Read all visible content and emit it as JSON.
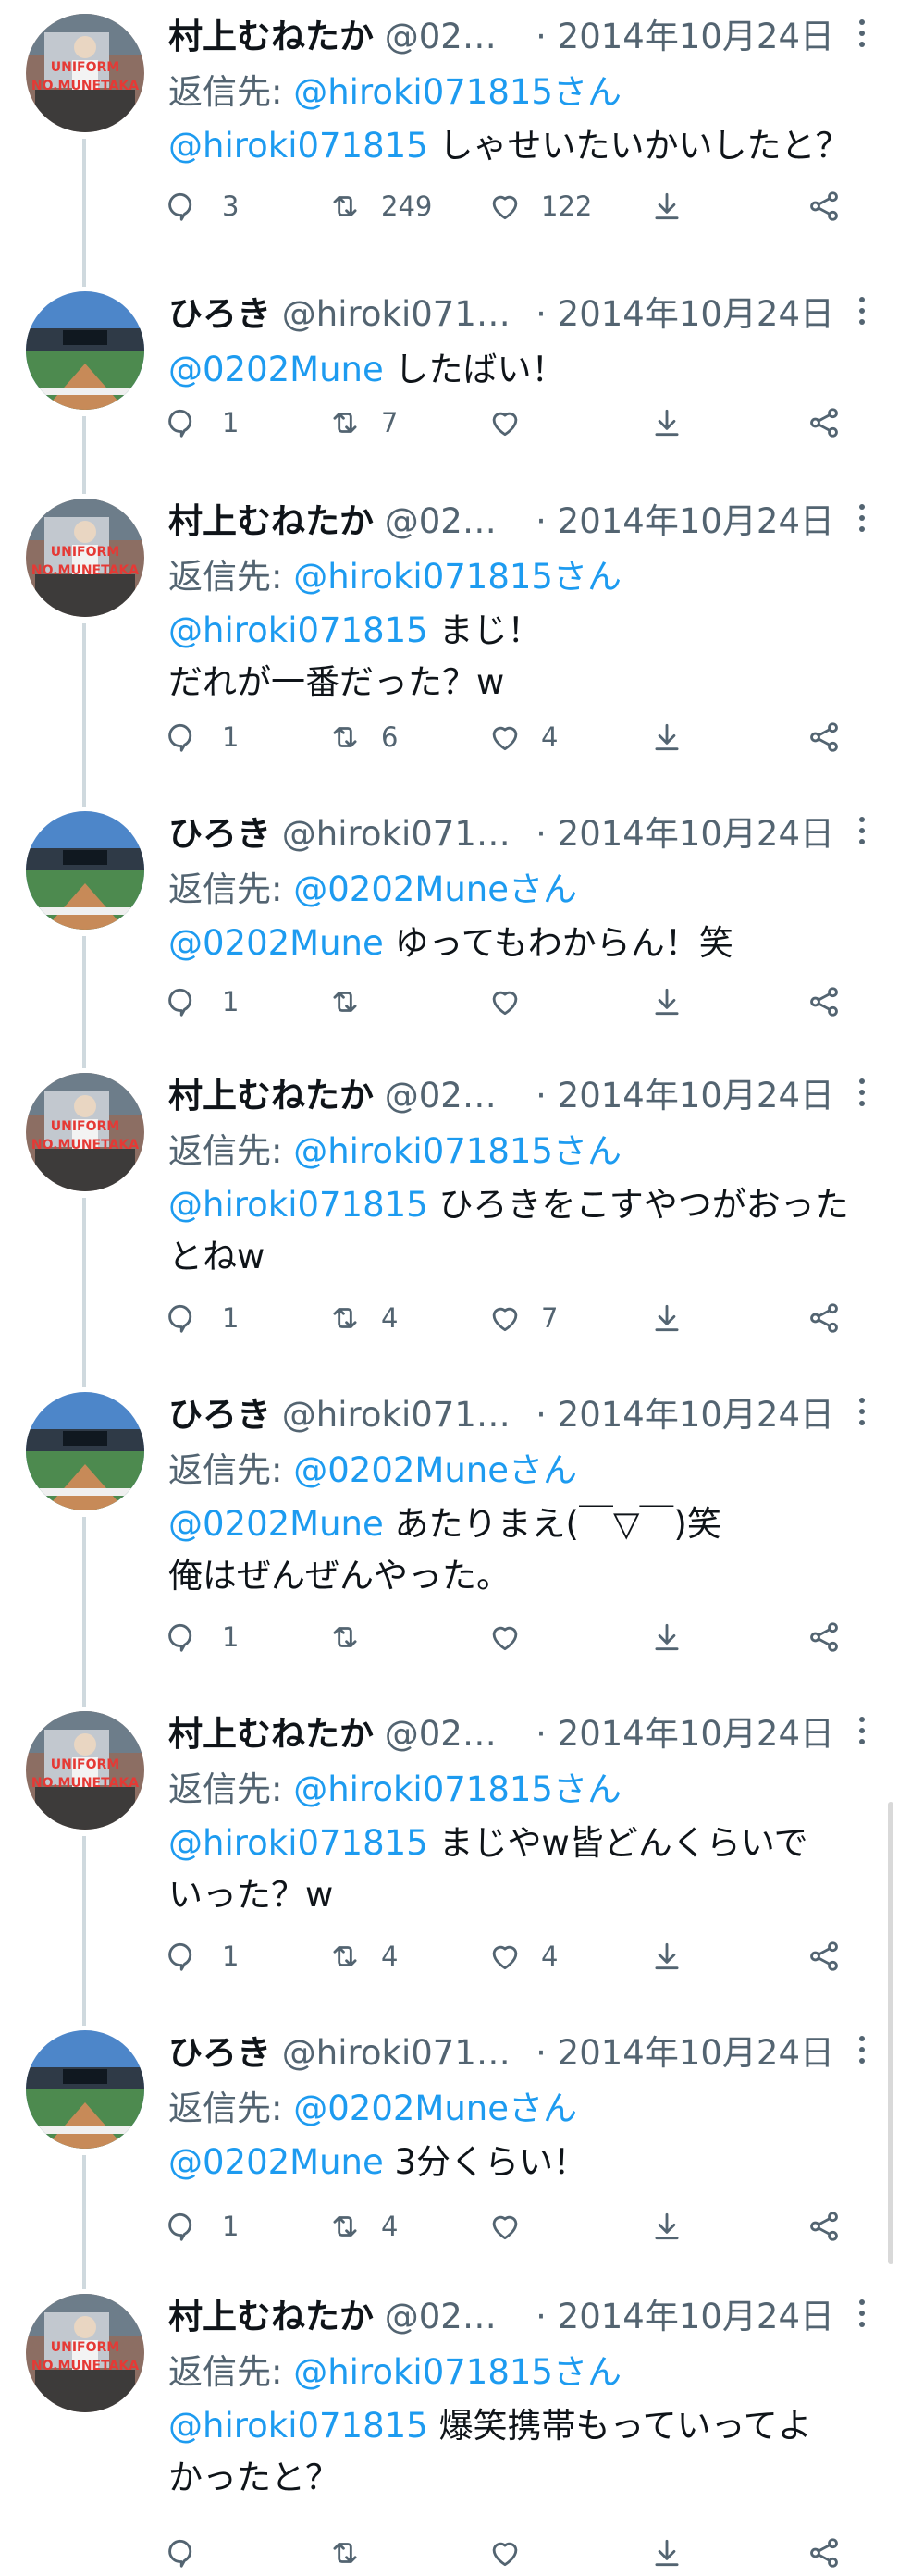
{
  "tweets": [
    {
      "author": "村上むねたか",
      "handle": "@02…",
      "date": "· 2014年10月24日",
      "reply_label": "返信先: ",
      "reply_handle": "@hiroki071815さん",
      "body_mention": "@hiroki071815",
      "body_lines": [
        " しゃせいたいかいしたと？"
      ],
      "stats": {
        "replies": "3",
        "retweets": "249",
        "likes": "122"
      }
    },
    {
      "author": "ひろき",
      "handle": "@hiroki071…",
      "date": "· 2014年10月24日",
      "body_mention": "@0202Mune",
      "body_lines": [
        " したばい！"
      ],
      "stats": {
        "replies": "1",
        "retweets": "7",
        "likes": ""
      }
    },
    {
      "author": "村上むねたか",
      "handle": "@02…",
      "date": "· 2014年10月24日",
      "reply_label": "返信先: ",
      "reply_handle": "@hiroki071815さん",
      "body_mention": "@hiroki071815",
      "body_lines": [
        " まじ！",
        "だれが一番だった？w"
      ],
      "stats": {
        "replies": "1",
        "retweets": "6",
        "likes": "4"
      }
    },
    {
      "author": "ひろき",
      "handle": "@hiroki071…",
      "date": "· 2014年10月24日",
      "reply_label": "返信先: ",
      "reply_handle": "@0202Muneさん",
      "body_mention": "@0202Mune",
      "body_lines": [
        " ゆってもわからん！笑"
      ],
      "stats": {
        "replies": "1",
        "retweets": "",
        "likes": ""
      }
    },
    {
      "author": "村上むねたか",
      "handle": "@02…",
      "date": "· 2014年10月24日",
      "reply_label": "返信先: ",
      "reply_handle": "@hiroki071815さん",
      "body_mention": "@hiroki071815",
      "body_lines": [
        " ひろきをこすやつがおった",
        "とねw"
      ],
      "stats": {
        "replies": "1",
        "retweets": "4",
        "likes": "7"
      }
    },
    {
      "author": "ひろき",
      "handle": "@hiroki071…",
      "date": "· 2014年10月24日",
      "reply_label": "返信先: ",
      "reply_handle": "@0202Muneさん",
      "body_mention": "@0202Mune",
      "body_lines": [
        " あたりまえ(￣▽￣)笑",
        "俺はぜんぜんやった。"
      ],
      "stats": {
        "replies": "1",
        "retweets": "",
        "likes": ""
      }
    },
    {
      "author": "村上むねたか",
      "handle": "@02…",
      "date": "· 2014年10月24日",
      "reply_label": "返信先: ",
      "reply_handle": "@hiroki071815さん",
      "body_mention": "@hiroki071815",
      "body_lines": [
        " まじやw皆どんくらいで",
        "いった？w"
      ],
      "stats": {
        "replies": "1",
        "retweets": "4",
        "likes": "4"
      }
    },
    {
      "author": "ひろき",
      "handle": "@hiroki071…",
      "date": "· 2014年10月24日",
      "reply_label": "返信先: ",
      "reply_handle": "@0202Muneさん",
      "body_mention": "@0202Mune",
      "body_lines": [
        " 3分くらい！"
      ],
      "stats": {
        "replies": "1",
        "retweets": "4",
        "likes": ""
      }
    },
    {
      "author": "村上むねたか",
      "handle": "@02…",
      "date": "· 2014年10月24日",
      "reply_label": "返信先: ",
      "reply_handle": "@hiroki071815さん",
      "body_mention": "@hiroki071815",
      "body_lines": [
        " 爆笑携帯もっていってよ",
        "かったと？"
      ],
      "stats": {
        "replies": "",
        "retweets": "",
        "likes": ""
      }
    }
  ],
  "icons": {
    "reply": "reply-icon",
    "retweet": "retweet-icon",
    "like": "like-icon",
    "share": "share-icon",
    "more_share": "share-network-icon",
    "more": "more-options-icon"
  },
  "colors": {
    "link": "#1d9bf0",
    "secondary_text": "#536471",
    "thread_line": "#cfd9de"
  }
}
